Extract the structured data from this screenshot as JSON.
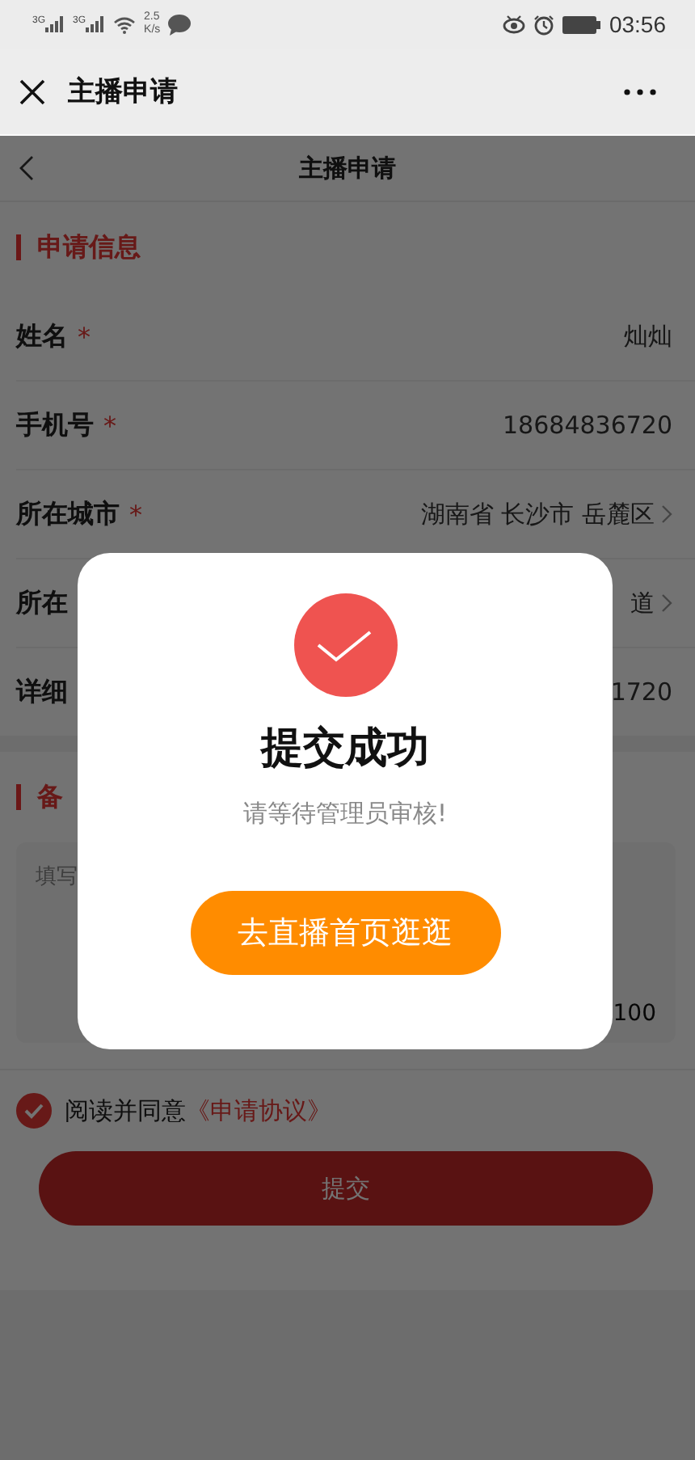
{
  "status_bar": {
    "signal_labels": [
      "3G",
      "3G"
    ],
    "speed_value": "2.5",
    "speed_unit": "K/s",
    "time": "03:56"
  },
  "wechat_bar": {
    "title": "主播申请"
  },
  "nav": {
    "title": "主播申请"
  },
  "info_section": {
    "title": "申请信息",
    "fields": [
      {
        "label": "姓名",
        "required_mark": "*",
        "value": "灿灿",
        "has_arrow": false
      },
      {
        "label": "手机号",
        "required_mark": "*",
        "value": "18684836720",
        "has_arrow": false
      },
      {
        "label": "所在城市",
        "required_mark": "*",
        "value": "湖南省 长沙市 岳麓区",
        "has_arrow": true
      },
      {
        "label": "所在",
        "value": "道",
        "has_arrow": true
      },
      {
        "label": "详细",
        "value": "1720",
        "has_arrow": false
      }
    ]
  },
  "remarks": {
    "title": "备",
    "placeholder": "填写",
    "counter": "100"
  },
  "agreement": {
    "checked": true,
    "text": "阅读并同意",
    "link": "《申请协议》"
  },
  "submit": {
    "label": "提交"
  },
  "dialog": {
    "title": "提交成功",
    "message": "请等待管理员审核!",
    "button": "去直播首页逛逛"
  }
}
